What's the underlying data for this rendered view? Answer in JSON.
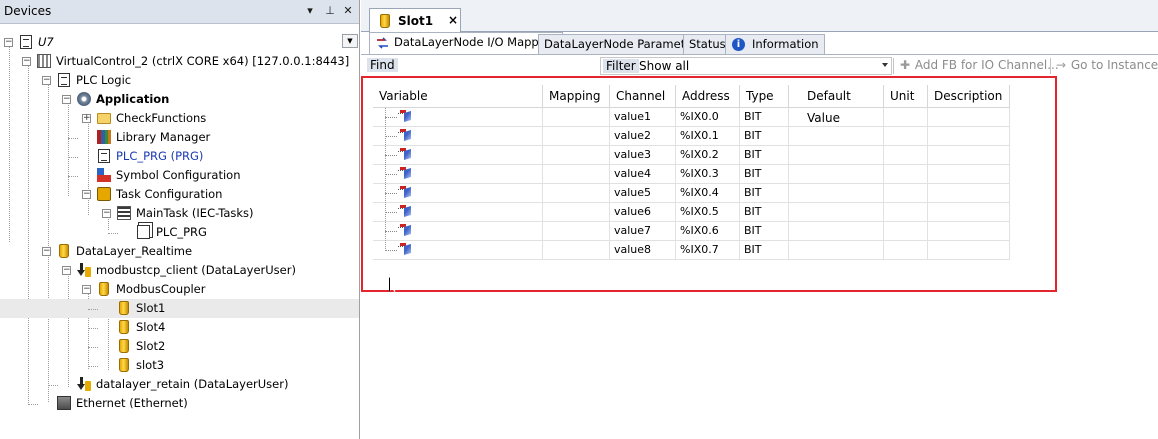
{
  "devices_pane": {
    "title": "Devices",
    "pin_glyph": "▾",
    "autohide_glyph": "⊥",
    "close_glyph": "✕",
    "tree": [
      {
        "label": "U7",
        "icon": "project-icon",
        "italic": true
      },
      {
        "label": "VirtualControl_2 (ctrlX CORE x64) [127.0.0.1:8443]",
        "icon": "device-icon"
      },
      {
        "label": "PLC Logic",
        "icon": "plc-logic-icon"
      },
      {
        "label": "Application",
        "icon": "application-gear-icon",
        "bold": true
      },
      {
        "label": "CheckFunctions",
        "icon": "folder-icon"
      },
      {
        "label": "Library Manager",
        "icon": "library-manager-icon"
      },
      {
        "label": "PLC_PRG (PRG)",
        "icon": "program-icon",
        "color": "#1a3bb3"
      },
      {
        "label": "Symbol Configuration",
        "icon": "symbol-configuration-icon"
      },
      {
        "label": "Task Configuration",
        "icon": "task-configuration-icon"
      },
      {
        "label": "MainTask (IEC-Tasks)",
        "icon": "task-stack-icon"
      },
      {
        "label": "PLC_PRG",
        "icon": "program-call-icon"
      },
      {
        "label": "DataLayer_Realtime",
        "icon": "datalayer-cylinder-icon"
      },
      {
        "label": "modbustcp_client (DataLayerUser)",
        "icon": "datalayer-user-icon"
      },
      {
        "label": "ModbusCoupler",
        "icon": "datalayer-cylinder-icon"
      },
      {
        "label": "Slot1",
        "icon": "datalayer-cylinder-icon",
        "selected": true
      },
      {
        "label": "Slot4",
        "icon": "datalayer-cylinder-icon"
      },
      {
        "label": "Slot2",
        "icon": "datalayer-cylinder-icon"
      },
      {
        "label": "slot3",
        "icon": "datalayer-cylinder-icon"
      },
      {
        "label": "datalayer_retain (DataLayerUser)",
        "icon": "datalayer-user-icon"
      },
      {
        "label": "Ethernet (Ethernet)",
        "icon": "ethernet-icon"
      }
    ]
  },
  "editor": {
    "document_tab": {
      "label": "Slot1",
      "close": "×"
    },
    "sub_tabs": [
      {
        "label": "DataLayerNode I/O Mapping",
        "active": true
      },
      {
        "label": "DataLayerNode Parameters"
      },
      {
        "label": "Status"
      },
      {
        "label": "Information"
      }
    ],
    "toolbar": {
      "find_label": "Find",
      "filter_label": "Filter",
      "filter_value": "Show all",
      "add_fb_label": "Add FB for IO Channel...",
      "go_to_instance_label": "Go to Instance"
    },
    "table": {
      "columns": [
        "Variable",
        "Mapping",
        "Channel",
        "Address",
        "Type",
        "Default Value",
        "Unit",
        "Description"
      ],
      "rows": [
        {
          "channel": "value1",
          "address": "%IX0.0",
          "type": "BIT"
        },
        {
          "channel": "value2",
          "address": "%IX0.1",
          "type": "BIT"
        },
        {
          "channel": "value3",
          "address": "%IX0.2",
          "type": "BIT"
        },
        {
          "channel": "value4",
          "address": "%IX0.3",
          "type": "BIT"
        },
        {
          "channel": "value5",
          "address": "%IX0.4",
          "type": "BIT"
        },
        {
          "channel": "value6",
          "address": "%IX0.5",
          "type": "BIT"
        },
        {
          "channel": "value7",
          "address": "%IX0.6",
          "type": "BIT"
        },
        {
          "channel": "value8",
          "address": "%IX0.7",
          "type": "BIT"
        }
      ]
    }
  },
  "colors": {
    "highlight_box": "#e3262e",
    "link_blue": "#1a3bb3",
    "header_bg": "#dde3ec"
  }
}
